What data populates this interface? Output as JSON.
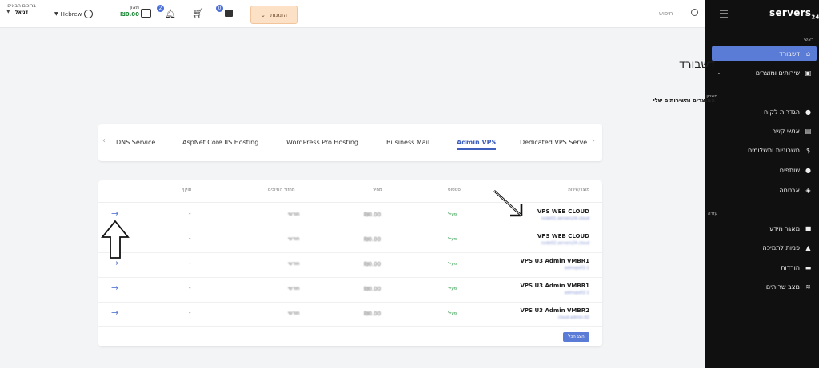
{
  "topbar": {
    "user_greeting": "ברוכים הבאים",
    "user_name": "דניאל",
    "language": "Hebrew",
    "balance_label": "מאזן",
    "balance_amount": "₪0.00",
    "notifications_count": "2",
    "cart_count": "0",
    "quotes_label": "הזמנות",
    "search_placeholder": "חיפוש"
  },
  "sidebar": {
    "logo": "servers",
    "logo_sub": "24",
    "section_main": "ראשי",
    "section_account": "חשבון",
    "section_help": "עזרה",
    "items": [
      {
        "label": "דשבורד",
        "icon": "home-icon"
      },
      {
        "label": "שירותים ומוצרים",
        "icon": "box-icon"
      },
      {
        "label": "הגדרות לקוח",
        "icon": "user-icon"
      },
      {
        "label": "אנשי קשר",
        "icon": "contacts-icon"
      },
      {
        "label": "חשבוניות ותשלומים",
        "icon": "dollar-icon"
      },
      {
        "label": "שותפים",
        "icon": "users-icon"
      },
      {
        "label": "אבטחה",
        "icon": "shield-icon"
      },
      {
        "label": "מאגר מידע",
        "icon": "book-icon"
      },
      {
        "label": "פניות לתמיכה",
        "icon": "ticket-icon"
      },
      {
        "label": "הורדות",
        "icon": "download-icon"
      },
      {
        "label": "מצב שרותים",
        "icon": "wifi-icon"
      }
    ]
  },
  "main": {
    "title": "דשבורד",
    "subtitle": "המוצרים והשירותים שלי",
    "tabs": [
      "DNS Service",
      "AspNet Core IIS Hosting",
      "WordPress Pro Hosting",
      "Business Mail",
      "Admin VPS",
      "Dedicated VPS Serve"
    ],
    "active_tab": "Admin VPS",
    "columns": [
      "מוצר/שירות",
      "סטטוס",
      "מחיר",
      "מחזור החיובים",
      "תוקף"
    ],
    "rows": [
      {
        "name": "VPS WEB CLOUD",
        "sub": "node01.servers24.cloud",
        "status": "פעיל",
        "price": "₪0.00",
        "cycle": "חודשי",
        "expiry": "-"
      },
      {
        "name": "VPS WEB CLOUD",
        "sub": "node02.servers24.cloud",
        "status": "פעיל",
        "price": "₪0.00",
        "cycle": "חודשי",
        "expiry": "-"
      },
      {
        "name": "VPS U3 Admin VMBR1",
        "sub": "admvps01-1",
        "status": "פעיל",
        "price": "₪0.00",
        "cycle": "חודשי",
        "expiry": "-"
      },
      {
        "name": "VPS U3 Admin VMBR1",
        "sub": "admvps02-1",
        "status": "פעיל",
        "price": "₪0.00",
        "cycle": "חודשי",
        "expiry": "-"
      },
      {
        "name": "VPS U3 Admin VMBR2",
        "sub": "cloud-admin-02",
        "status": "פעיל",
        "price": "₪0.00",
        "cycle": "חודשי",
        "expiry": "-"
      }
    ],
    "show_all": "הצג הכל"
  }
}
